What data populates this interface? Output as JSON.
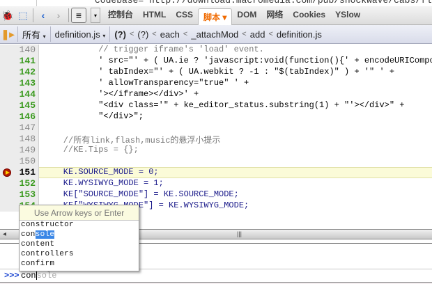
{
  "background_page": {
    "text": "codebase=\"http://download.macromedia.com/pub/shockwave/cabs/flash/swflash.c"
  },
  "toolbar": {
    "tabs": [
      "控制台",
      "HTML",
      "CSS",
      "脚本",
      "DOM",
      "网络",
      "Cookies",
      "YSlow"
    ],
    "active_tab": "脚本"
  },
  "script_bar": {
    "filter": "所有",
    "file": "definition.js",
    "stack": [
      "(?)",
      "(?)",
      "each",
      "_attachMod",
      "add",
      "definition.js"
    ]
  },
  "code": {
    "lines": [
      {
        "n": "140",
        "text": "// trigger iframe's 'load' event."
      },
      {
        "n": "141",
        "text": "' src=\"' + ( UA.ie ? 'javascript:void(function(){' + encodeURICompo"
      },
      {
        "n": "142",
        "text": "' tabIndex=\"' + ( UA.webkit ? -1 : \"$(tabIndex)\" ) + '\" ' +"
      },
      {
        "n": "143",
        "text": "' allowTransparency=\"true\" ' +"
      },
      {
        "n": "144",
        "text": "'></iframe></div>' +"
      },
      {
        "n": "145",
        "text": "\"<div class='\" + ke_editor_status.substring(1) + \"'></div>\" +"
      },
      {
        "n": "146",
        "text": "\"</div>\";"
      },
      {
        "n": "147",
        "text": ""
      },
      {
        "n": "148",
        "text": "//所有link,flash,music的悬浮小提示"
      },
      {
        "n": "149",
        "text": "//KE.Tips = {};"
      },
      {
        "n": "150",
        "text": ""
      },
      {
        "n": "151",
        "text": "KE.SOURCE_MODE = 0;"
      },
      {
        "n": "152",
        "text": "KE.WYSIWYG_MODE = 1;"
      },
      {
        "n": "153",
        "text": "KE[\"SOURCE_MODE\"] = KE.SOURCE_MODE;"
      },
      {
        "n": "154",
        "text": "KE[\"WYSIWYG_MODE\"] = KE.WYSIWYG_MODE;"
      }
    ]
  },
  "autocomplete": {
    "hint": "Use Arrow keys or Enter",
    "typed": "con",
    "items": [
      {
        "pre": "con",
        "rest": "structor"
      },
      {
        "pre": "con",
        "rest": "sole"
      },
      {
        "pre": "con",
        "rest": "tent"
      },
      {
        "pre": "con",
        "rest": "trollers"
      },
      {
        "pre": "con",
        "rest": "firm"
      }
    ],
    "selected": 1
  },
  "console": {
    "prompt": ">>>",
    "typed": "con",
    "suggestion": "sole"
  }
}
